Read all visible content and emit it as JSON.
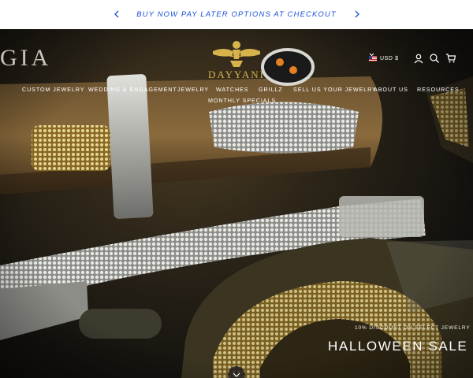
{
  "announcement": {
    "text": "BUY NOW PAY LATER OPTIONS AT CHECKOUT",
    "prev_icon": "chevron-left-icon",
    "next_icon": "chevron-right-icon",
    "color": "#1c4fd8"
  },
  "header": {
    "logo_text": "DAYYANI",
    "background_mark": "GIA",
    "currency": "USD $",
    "icons": [
      "account-icon",
      "search-icon",
      "cart-icon"
    ]
  },
  "nav": {
    "items": [
      "CUSTOM JEWELRY",
      "WEDDING & ENGAGEMENT",
      "JEWELRY",
      "WATCHES",
      "GRILLZ",
      "SELL US YOUR JEWELRY",
      "ABOUT US",
      "RESOURCES",
      "MONTHLY SPECIALS"
    ]
  },
  "hero": {
    "promo_subtitle": "10% DISCOUNT ON SELECT JEWELRY",
    "promo_title": "HALLOWEEN SALE",
    "accent_gold": "#d8b24a"
  }
}
